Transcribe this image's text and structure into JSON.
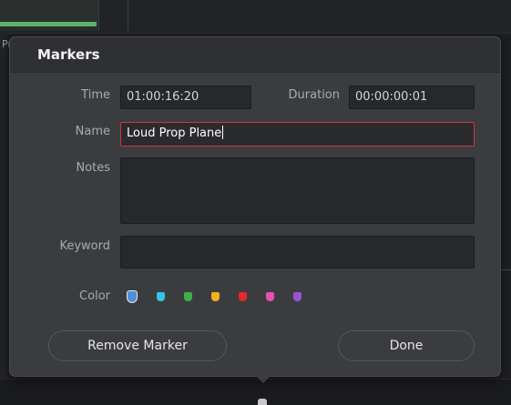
{
  "background": {
    "left_label": "Pr"
  },
  "dialog": {
    "title": "Markers",
    "time_label": "Time",
    "time_value": "01:00:16:20",
    "duration_label": "Duration",
    "duration_value": "00:00:00:01",
    "name_label": "Name",
    "name_value": "Loud Prop Plane",
    "notes_label": "Notes",
    "notes_value": "",
    "keyword_label": "Keyword",
    "keyword_value": "",
    "color_label": "Color",
    "colors": [
      {
        "name": "blue",
        "hex": "#4f8fdc",
        "selected": true
      },
      {
        "name": "cyan",
        "hex": "#35c3e6",
        "selected": false
      },
      {
        "name": "green",
        "hex": "#3fae47",
        "selected": false
      },
      {
        "name": "yellow",
        "hex": "#f0b21e",
        "selected": false
      },
      {
        "name": "red",
        "hex": "#e52a2a",
        "selected": false
      },
      {
        "name": "pink",
        "hex": "#e84fb3",
        "selected": false
      },
      {
        "name": "purple",
        "hex": "#9b52d6",
        "selected": false
      }
    ],
    "remove_button": "Remove Marker",
    "done_button": "Done"
  }
}
